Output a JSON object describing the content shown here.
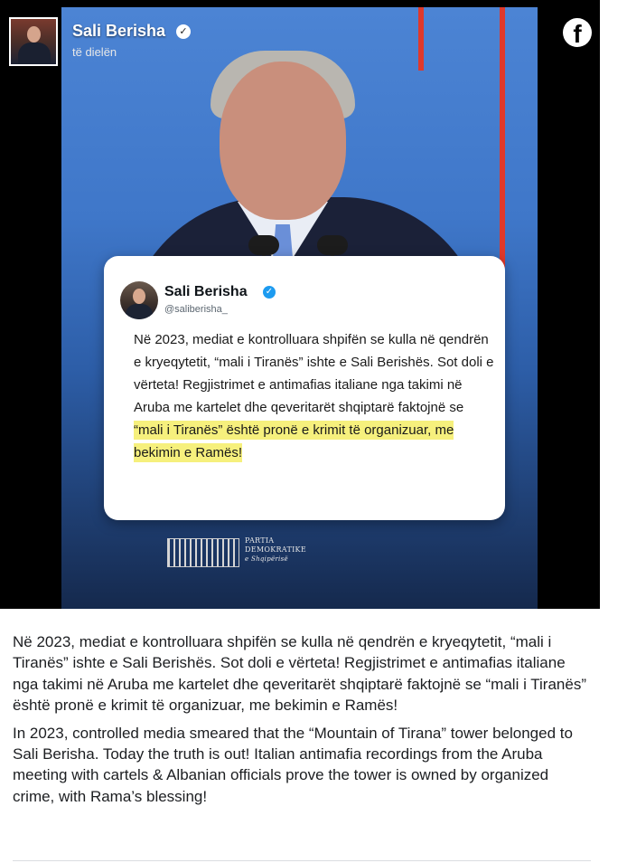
{
  "post": {
    "author": "Sali Berisha",
    "timestamp": "të dielën",
    "platform_icon": "facebook-icon",
    "verified_icon": "verified-badge-icon"
  },
  "image_card": {
    "tweet": {
      "name": "Sali Berisha",
      "handle": "@saliberisha_",
      "text_plain": "Në 2023, mediat e kontrolluara shpifën se kulla në qendrën e kryeqytetit, “mali i Tiranës” ishte e Sali Berishës. Sot doli e vërteta! Regjistrimet e antimafias italiane nga takimi në Aruba me kartelet dhe qeveritarët shqiptarë faktojnë se ",
      "text_highlight": "“mali i Tiranës” është pronë e krimit të organizuar, me bekimin e Ramës!",
      "highlight_color": "#f6f07d"
    },
    "logo": {
      "line1": "PARTIA",
      "line2": "DEMOKRATIKE",
      "line3": "e Shqipërisë"
    }
  },
  "caption": {
    "albanian": "Në 2023, mediat e kontrolluara shpifën se kulla në qendrën e kryeqytetit, “mali i Tiranës” ishte e Sali Berishës. Sot doli e vërteta! Regjistrimet e antimafias italiane nga takimi në Aruba me kartelet dhe qeveritarët shqiptarë faktojnë se “mali i Tiranës” është pronë e krimit të organizuar, me bekimin e Ramës!",
    "english": "In 2023, controlled media smeared that the “Mountain of Tirana” tower belonged to Sali Berisha. Today the truth is out! Italian antimafia recordings from the Aruba meeting with cartels & Albanian officials prove the tower is owned by organized crime, with Rama’s blessing!"
  },
  "colors": {
    "accent_red": "#e0392b",
    "background_blue": "#3f77c9",
    "verified_blue": "#1d9bf0"
  }
}
